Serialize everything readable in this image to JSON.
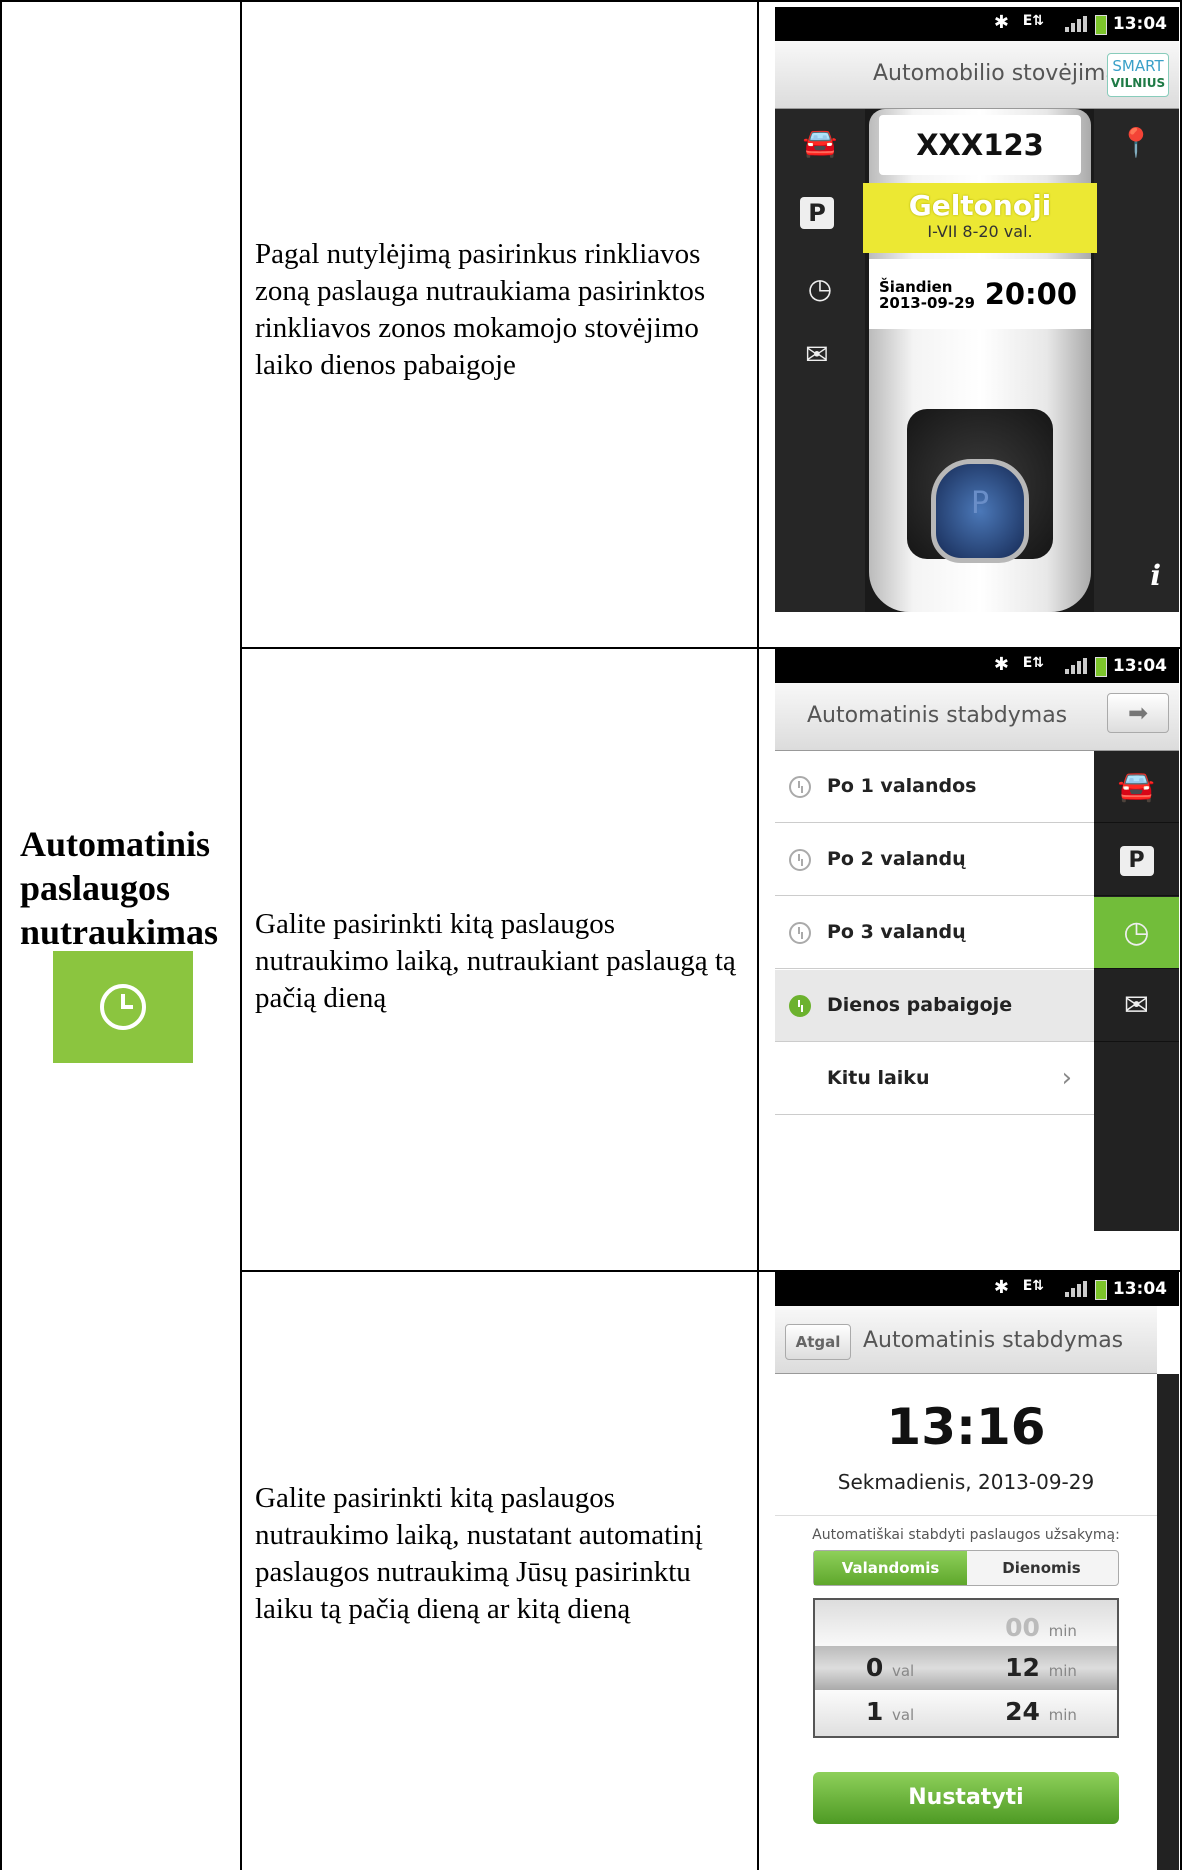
{
  "category": {
    "title": "Automatinis paslaugos nutraukimas",
    "icon": "clock-icon"
  },
  "rows": [
    {
      "description": "Pagal nutylėjimą pasirinkus rinkliavos zoną paslauga nutraukiama pasirinktos rinkliavos zonos mokamojo stovėjimo laiko dienos pabaigoje"
    },
    {
      "description": "Galite pasirinkti kitą paslaugos nutraukimo laiką, nutraukiant paslaugą tą pačią dieną"
    },
    {
      "description": "Galite pasirinkti kitą paslaugos nutraukimo laiką, nustatant automatinį paslaugos nutraukimą Jūsų pasirinktu laiku tą pačią dieną ar kitą dieną"
    }
  ],
  "status_time": "13:04",
  "screen1": {
    "title": "Automobilio stovėjimas",
    "logo_top": "SMART",
    "logo_bottom": "VILNIUS",
    "plate": "XXX123",
    "zone_name": "Geltonoji",
    "zone_hours": "I-VII 8-20 val.",
    "day_label": "Šiandien",
    "date": "2013-09-29",
    "end_time": "20:00",
    "info": "i"
  },
  "screen2": {
    "title": "Automatinis stabdymas",
    "options": [
      {
        "label": "Po 1 valandos"
      },
      {
        "label": "Po 2 valandų"
      },
      {
        "label": "Po 3 valandų"
      },
      {
        "label": "Dienos pabaigoje",
        "selected": true
      },
      {
        "label": "Kitu laiku"
      }
    ]
  },
  "screen3": {
    "back": "Atgal",
    "title": "Automatinis stabdymas",
    "time": "13:16",
    "date": "Sekmadienis, 2013-09-29",
    "hint": "Automatiškai stabdyti paslaugos užsakymą:",
    "tab_hours": "Valandomis",
    "tab_days": "Dienomis",
    "picker_left": [
      {
        "value": "0",
        "unit": "val"
      },
      {
        "value": "1",
        "unit": "val"
      }
    ],
    "picker_right": [
      {
        "value": "00",
        "unit": "min"
      },
      {
        "value": "12",
        "unit": "min"
      },
      {
        "value": "24",
        "unit": "min"
      }
    ],
    "button": "Nustatyti"
  }
}
